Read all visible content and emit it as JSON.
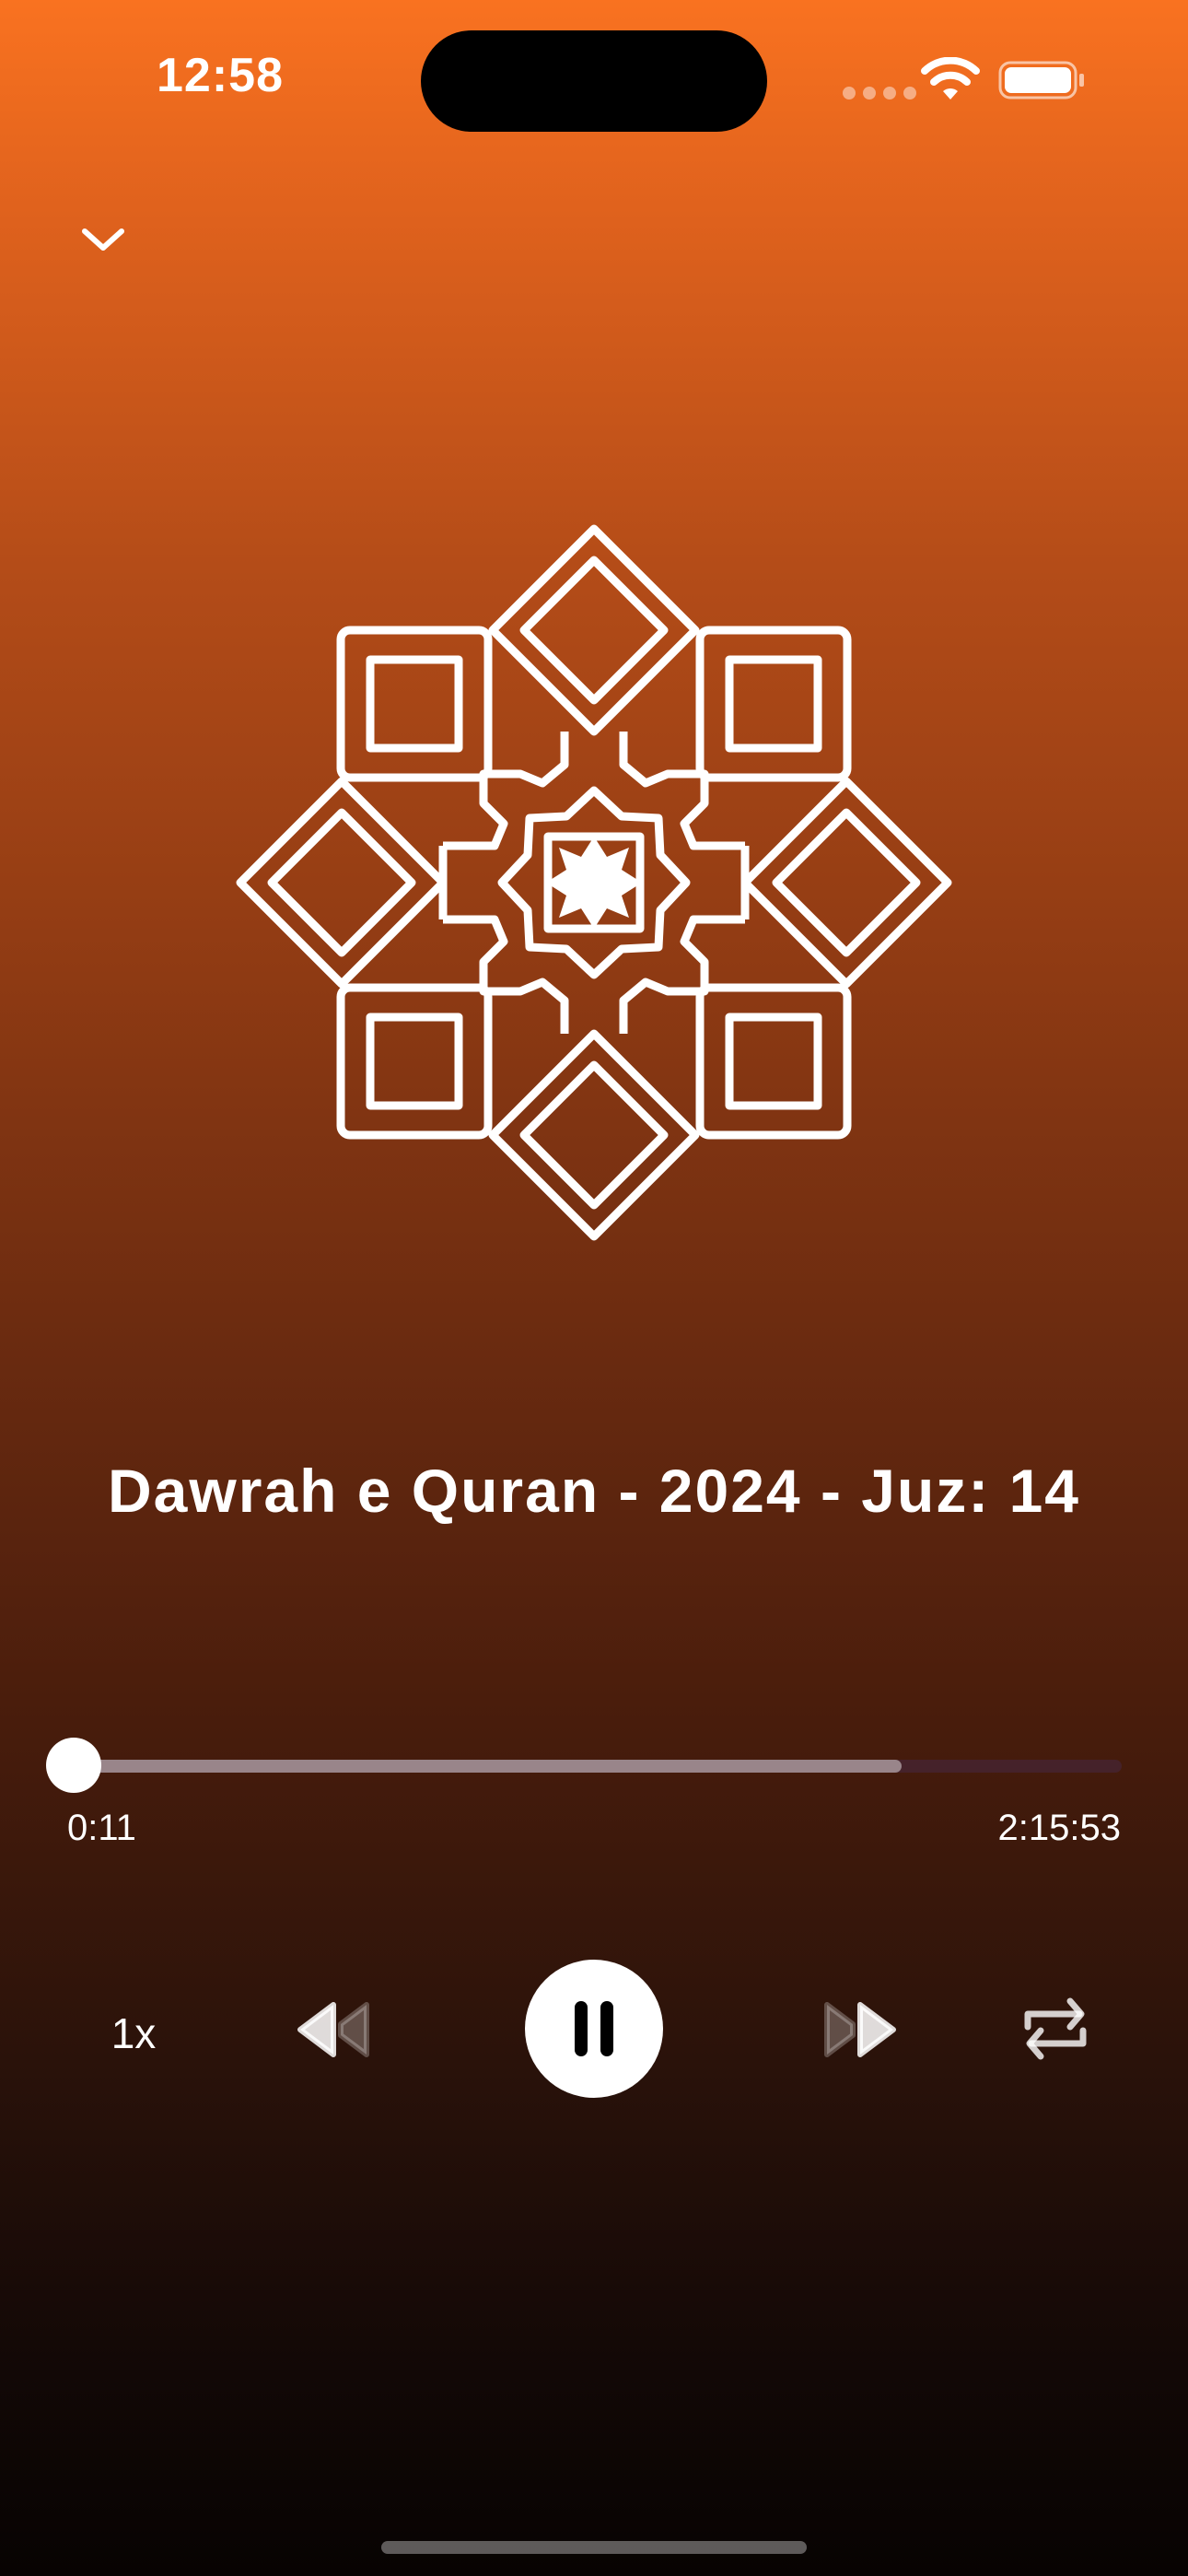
{
  "status_bar": {
    "time": "12:58",
    "battery_level": 1.0
  },
  "header": {
    "collapse_icon": "chevron-down-icon"
  },
  "artwork": {
    "icon": "islamic-geometric-star-pattern"
  },
  "track": {
    "title": "Dawrah e Quran - 2024 - Juz: 14"
  },
  "progress": {
    "elapsed": "0:11",
    "total": "2:15:53",
    "played_fraction": 0.0,
    "buffered_fraction": 0.79
  },
  "controls": {
    "speed_label": "1x",
    "rewind_icon": "rewind-icon",
    "play_pause_icon": "pause-icon",
    "forward_icon": "fast-forward-icon",
    "repeat_icon": "repeat-icon"
  },
  "colors": {
    "gradient_top": "#f97220",
    "gradient_bottom": "#070302",
    "accent": "#ffffff"
  }
}
